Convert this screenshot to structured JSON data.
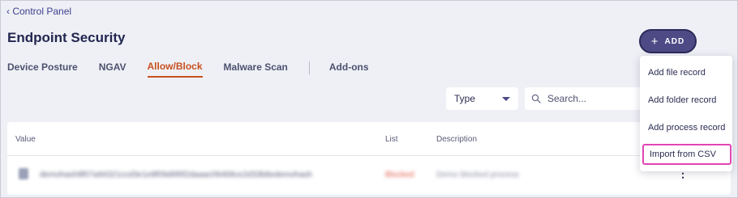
{
  "breadcrumb": {
    "label": "‹ Control Panel"
  },
  "page": {
    "title": "Endpoint Security"
  },
  "tabs": [
    {
      "label": "Device Posture",
      "active": false
    },
    {
      "label": "NGAV",
      "active": false
    },
    {
      "label": "Allow/Block",
      "active": true
    },
    {
      "label": "Malware Scan",
      "active": false
    },
    {
      "label": "Add-ons",
      "active": false
    }
  ],
  "toolbar": {
    "add_label": "ADD",
    "add_icon": "plus-icon",
    "type_select": {
      "value": "Type"
    },
    "search": {
      "placeholder": "Search...",
      "value": ""
    }
  },
  "add_menu": {
    "items": [
      {
        "label": "Add file record"
      },
      {
        "label": "Add folder record"
      },
      {
        "label": "Add process record"
      },
      {
        "label": "Import from CSV",
        "highlighted": true
      }
    ]
  },
  "table": {
    "columns": {
      "value": "Value",
      "list": "List",
      "description": "Description"
    },
    "rows": [
      {
        "value": "demohash8f07a94321ccd3e1e8f09d6f6f2daaac09468ce2d33b8edemohash",
        "list": "Blocked",
        "description": "Demo blocked process"
      }
    ]
  },
  "colors": {
    "accent": "#4d4a86",
    "active_tab": "#c8501f",
    "highlight_border": "#e046b4",
    "blocked": "#e05a4a"
  }
}
